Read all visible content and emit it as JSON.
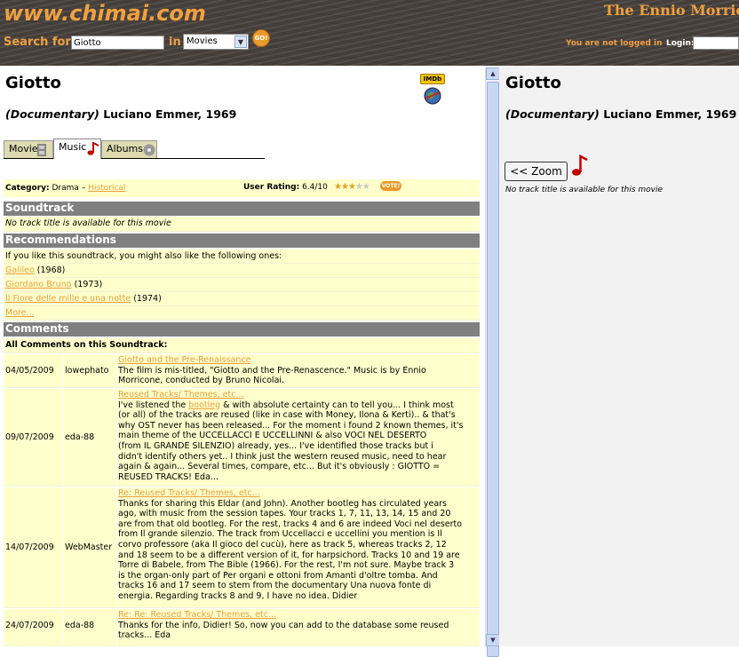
{
  "header": {
    "logo": "www.chimai.com",
    "site_title": "The Ennio Morricone",
    "search_label": "Search for:",
    "search_value": "Giotto",
    "in_label": "in",
    "category_selected": "Movies",
    "go_label": "GO!",
    "login_status": "You are not logged in",
    "login_label": "Login:"
  },
  "movie": {
    "title": "Giotto",
    "type": "(Documentary)",
    "director_year": "Luciano Emmer, 1969",
    "imdb_label": "IMDb"
  },
  "tabs": [
    {
      "label": "Movie"
    },
    {
      "label": "Music"
    },
    {
      "label": "Albums"
    }
  ],
  "info": {
    "category_label": "Category:",
    "category_value": "Drama",
    "category_sep": "–",
    "category_link": "Historical",
    "user_rating_label": "User Rating:",
    "user_rating_value": "6.4/10",
    "rating_score": 6.4,
    "rating_max": 10,
    "vote_label": "VOTE!"
  },
  "soundtrack": {
    "heading": "Soundtrack",
    "note": "No track title is available for this movie"
  },
  "recommendations": {
    "heading": "Recommendations",
    "intro": "If you like this soundtrack, you might also like the following ones:",
    "items": [
      {
        "title": "Galileo",
        "year": "(1968)"
      },
      {
        "title": "Giordano Bruno",
        "year": "(1973)"
      },
      {
        "title": "Il Fiore delle mille e una notte",
        "year": "(1974)"
      }
    ],
    "more": "More..."
  },
  "comments": {
    "heading": "Comments",
    "subheading": "All Comments on this Soundtrack:",
    "items": [
      {
        "date": "04/05/2009",
        "user": "lowephato",
        "title": "Giotto and the Pre-Renaissance",
        "lines": [
          "The film is mis-titled, \"Giotto and the Pre-Renascence.\" Music is by Ennio",
          "Morricone, conducted by Bruno Nicolai."
        ]
      },
      {
        "date": "09/07/2009",
        "user": "eda-88",
        "title": "Reused Tracks/ Themes, etc...",
        "line1_pre": "I've listened the ",
        "line1_link": "bootleg",
        "line1_post": " & with absolute certainty can to tell you... I think most",
        "lines": [
          "(or all) of the tracks are reused (like in case with Money, Ilona & Kerti).. & that's",
          "why OST never has been released... For the moment i found 2 known themes, it's",
          "main theme of the UCCELLACCI E UCCELLINNI & also VOCI NEL DESERTO",
          "(from IL GRANDE SILENZIO) already, yes... I've identified those tracks but i",
          "didn't identify others yet.. I think just the western reused music, need to hear",
          "again & again... Several times, compare, etc... But it's obviously : GIOTTO =",
          "REUSED TRACKS! Eda..."
        ]
      },
      {
        "date": "14/07/2009",
        "user": "WebMaster",
        "title": "Re: Reused Tracks/ Themes, etc...",
        "lines": [
          "Thanks for sharing this Eldar (and John). Another bootleg has circulated years",
          "ago, with music from the session tapes. Your tracks 1, 7, 11, 13, 14, 15 and 20",
          "are from that old bootleg. For the rest, tracks 4 and 6 are indeed Voci nel deserto",
          "from Il grande silenzio. The track from Uccellacci e uccellini you mention is Il",
          "corvo professore (aka Il gioco del cucù), here as track 5, whereas tracks 2, 12",
          "and 18 seem to be a different version of it, for harpsichord. Tracks 10 and 19 are",
          "Torre di Babele, from The Bible (1966). For the rest, I'm not sure. Maybe track 3",
          "is the organ-only part of Per organi e ottoni from Amanti d'oltre tomba. And",
          "tracks 16 and 17 seem to stem from the documentary Una nuova fonte di",
          "energia. Regarding tracks 8 and 9, I have no idea. Didier"
        ]
      },
      {
        "date": "24/07/2009",
        "user": "eda-88",
        "title": "Re: Re: Reused Tracks/ Themes, etc...",
        "lines": [
          "Thanks for the info, Didier! So, now you can add to the database some reused",
          "tracks... Eda"
        ]
      }
    ]
  },
  "right_panel": {
    "title": "Giotto",
    "type": "(Documentary)",
    "director_year": "Luciano Emmer, 1969",
    "zoom_label": "<< Zoom",
    "note": "No track title is available for this movie"
  }
}
